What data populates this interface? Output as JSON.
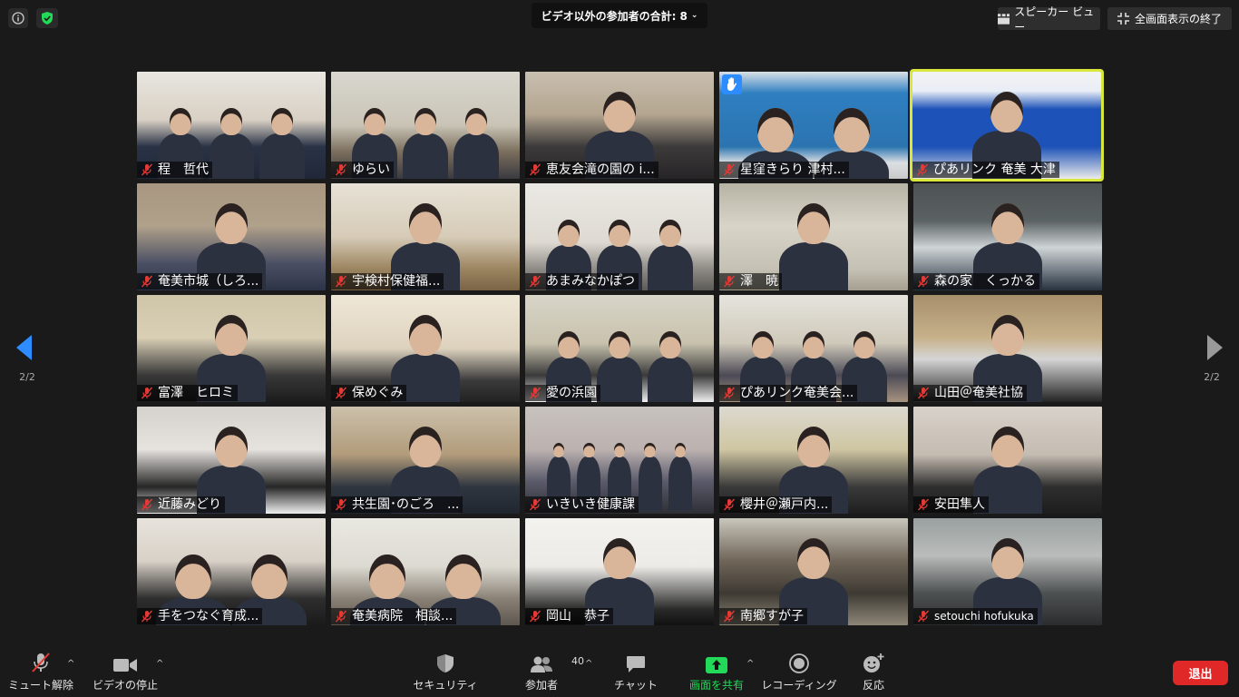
{
  "topbar": {
    "participant_count_label": "ビデオ以外の参加者の合計: 8",
    "speaker_view_label": "スピーカー ビュー",
    "exit_fullscreen_label": "全画面表示の終了"
  },
  "navigation": {
    "left_page": "2/2",
    "right_page": "2/2"
  },
  "participants": [
    {
      "name": "程　哲代",
      "scene": "office1"
    },
    {
      "name": "ゆらい",
      "scene": "room1"
    },
    {
      "name": "恵友会滝の園の i...",
      "scene": "room2"
    },
    {
      "name": "星窪きらり 津村...",
      "scene": "blue",
      "hand": true
    },
    {
      "name": "ぴあリンク 奄美 大津",
      "scene": "web",
      "active": true
    },
    {
      "name": "奄美市城（しろ...",
      "scene": "man1"
    },
    {
      "name": "宇検村保健福...",
      "scene": "room3"
    },
    {
      "name": "あまみなかぽつ",
      "scene": "room4"
    },
    {
      "name": "澤　暁",
      "scene": "board"
    },
    {
      "name": "森の家　くっかる",
      "scene": "mask"
    },
    {
      "name": "富澤　ヒロミ",
      "scene": "woman1"
    },
    {
      "name": "保めぐみ",
      "scene": "woman2"
    },
    {
      "name": "愛の浜園",
      "scene": "group3"
    },
    {
      "name": "ぴあリンク奄美会...",
      "scene": "meeting"
    },
    {
      "name": "山田＠奄美社協",
      "scene": "man2"
    },
    {
      "name": "近藤みどり",
      "scene": "woman3"
    },
    {
      "name": "共生園･のごろ　...",
      "scene": "woman4"
    },
    {
      "name": "いきいき健康課",
      "scene": "hall"
    },
    {
      "name": "櫻井＠瀬戸内...",
      "scene": "man3"
    },
    {
      "name": "安田隼人",
      "scene": "man4"
    },
    {
      "name": "手をつなぐ育成...",
      "scene": "two"
    },
    {
      "name": "奄美病院　相談...",
      "scene": "hospital"
    },
    {
      "name": "岡山　恭子",
      "scene": "woman5"
    },
    {
      "name": "南郷すが子",
      "scene": "shelf"
    },
    {
      "name": "setouchi hofukuka",
      "scene": "office2",
      "small": true
    }
  ],
  "toolbar": {
    "mute_label": "ミュート解除",
    "video_label": "ビデオの停止",
    "security_label": "セキュリティ",
    "participants_label": "参加者",
    "participants_count": "40",
    "chat_label": "チャット",
    "share_label": "画面を共有",
    "record_label": "レコーディング",
    "reactions_label": "反応",
    "leave_label": "退出"
  },
  "colors": {
    "accent_blue": "#2d8cff",
    "share_green": "#23d959",
    "leave_red": "#e02828",
    "active_speaker": "#d9e63a",
    "mic_off_red": "#e53935"
  }
}
